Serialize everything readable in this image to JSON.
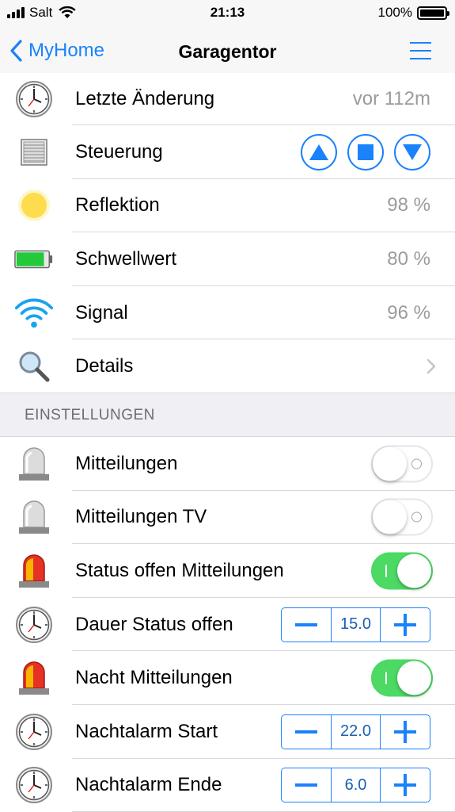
{
  "statusbar": {
    "carrier": "Salt",
    "time": "21:13",
    "battery": "100%"
  },
  "nav": {
    "back_label": "MyHome",
    "title": "Garagentor",
    "menu_icon": "hamburger-menu-icon"
  },
  "accent": "#1a82fb",
  "rows": [
    {
      "icon": "clock-icon",
      "label": "Letzte Änderung",
      "value": "vor 112m"
    },
    {
      "icon": "shutter-icon",
      "label": "Steuerung",
      "controls": [
        "up-triangle-icon",
        "stop-square-icon",
        "down-triangle-icon"
      ]
    },
    {
      "icon": "sun-icon",
      "label": "Reflektion",
      "value": "98 %"
    },
    {
      "icon": "battery-icon",
      "label": "Schwellwert",
      "value": "80 %"
    },
    {
      "icon": "wifi-icon",
      "label": "Signal",
      "value": "96 %"
    },
    {
      "icon": "magnifier-icon",
      "label": "Details"
    }
  ],
  "settings_header": "EINSTELLUNGEN",
  "settings": [
    {
      "icon": "siren-gray-icon",
      "label": "Mitteilungen",
      "toggle": false
    },
    {
      "icon": "siren-gray-icon",
      "label": "Mitteilungen TV",
      "toggle": false
    },
    {
      "icon": "siren-red-icon",
      "label": "Status offen Mitteilungen",
      "toggle": true
    },
    {
      "icon": "clock-icon",
      "label": "Dauer Status offen",
      "stepper": "15.0"
    },
    {
      "icon": "siren-red-icon",
      "label": "Nacht Mitteilungen",
      "toggle": true
    },
    {
      "icon": "clock-icon",
      "label": "Nachtalarm Start",
      "stepper": "22.0"
    },
    {
      "icon": "clock-icon",
      "label": "Nachtalarm Ende",
      "stepper": "6.0"
    }
  ]
}
